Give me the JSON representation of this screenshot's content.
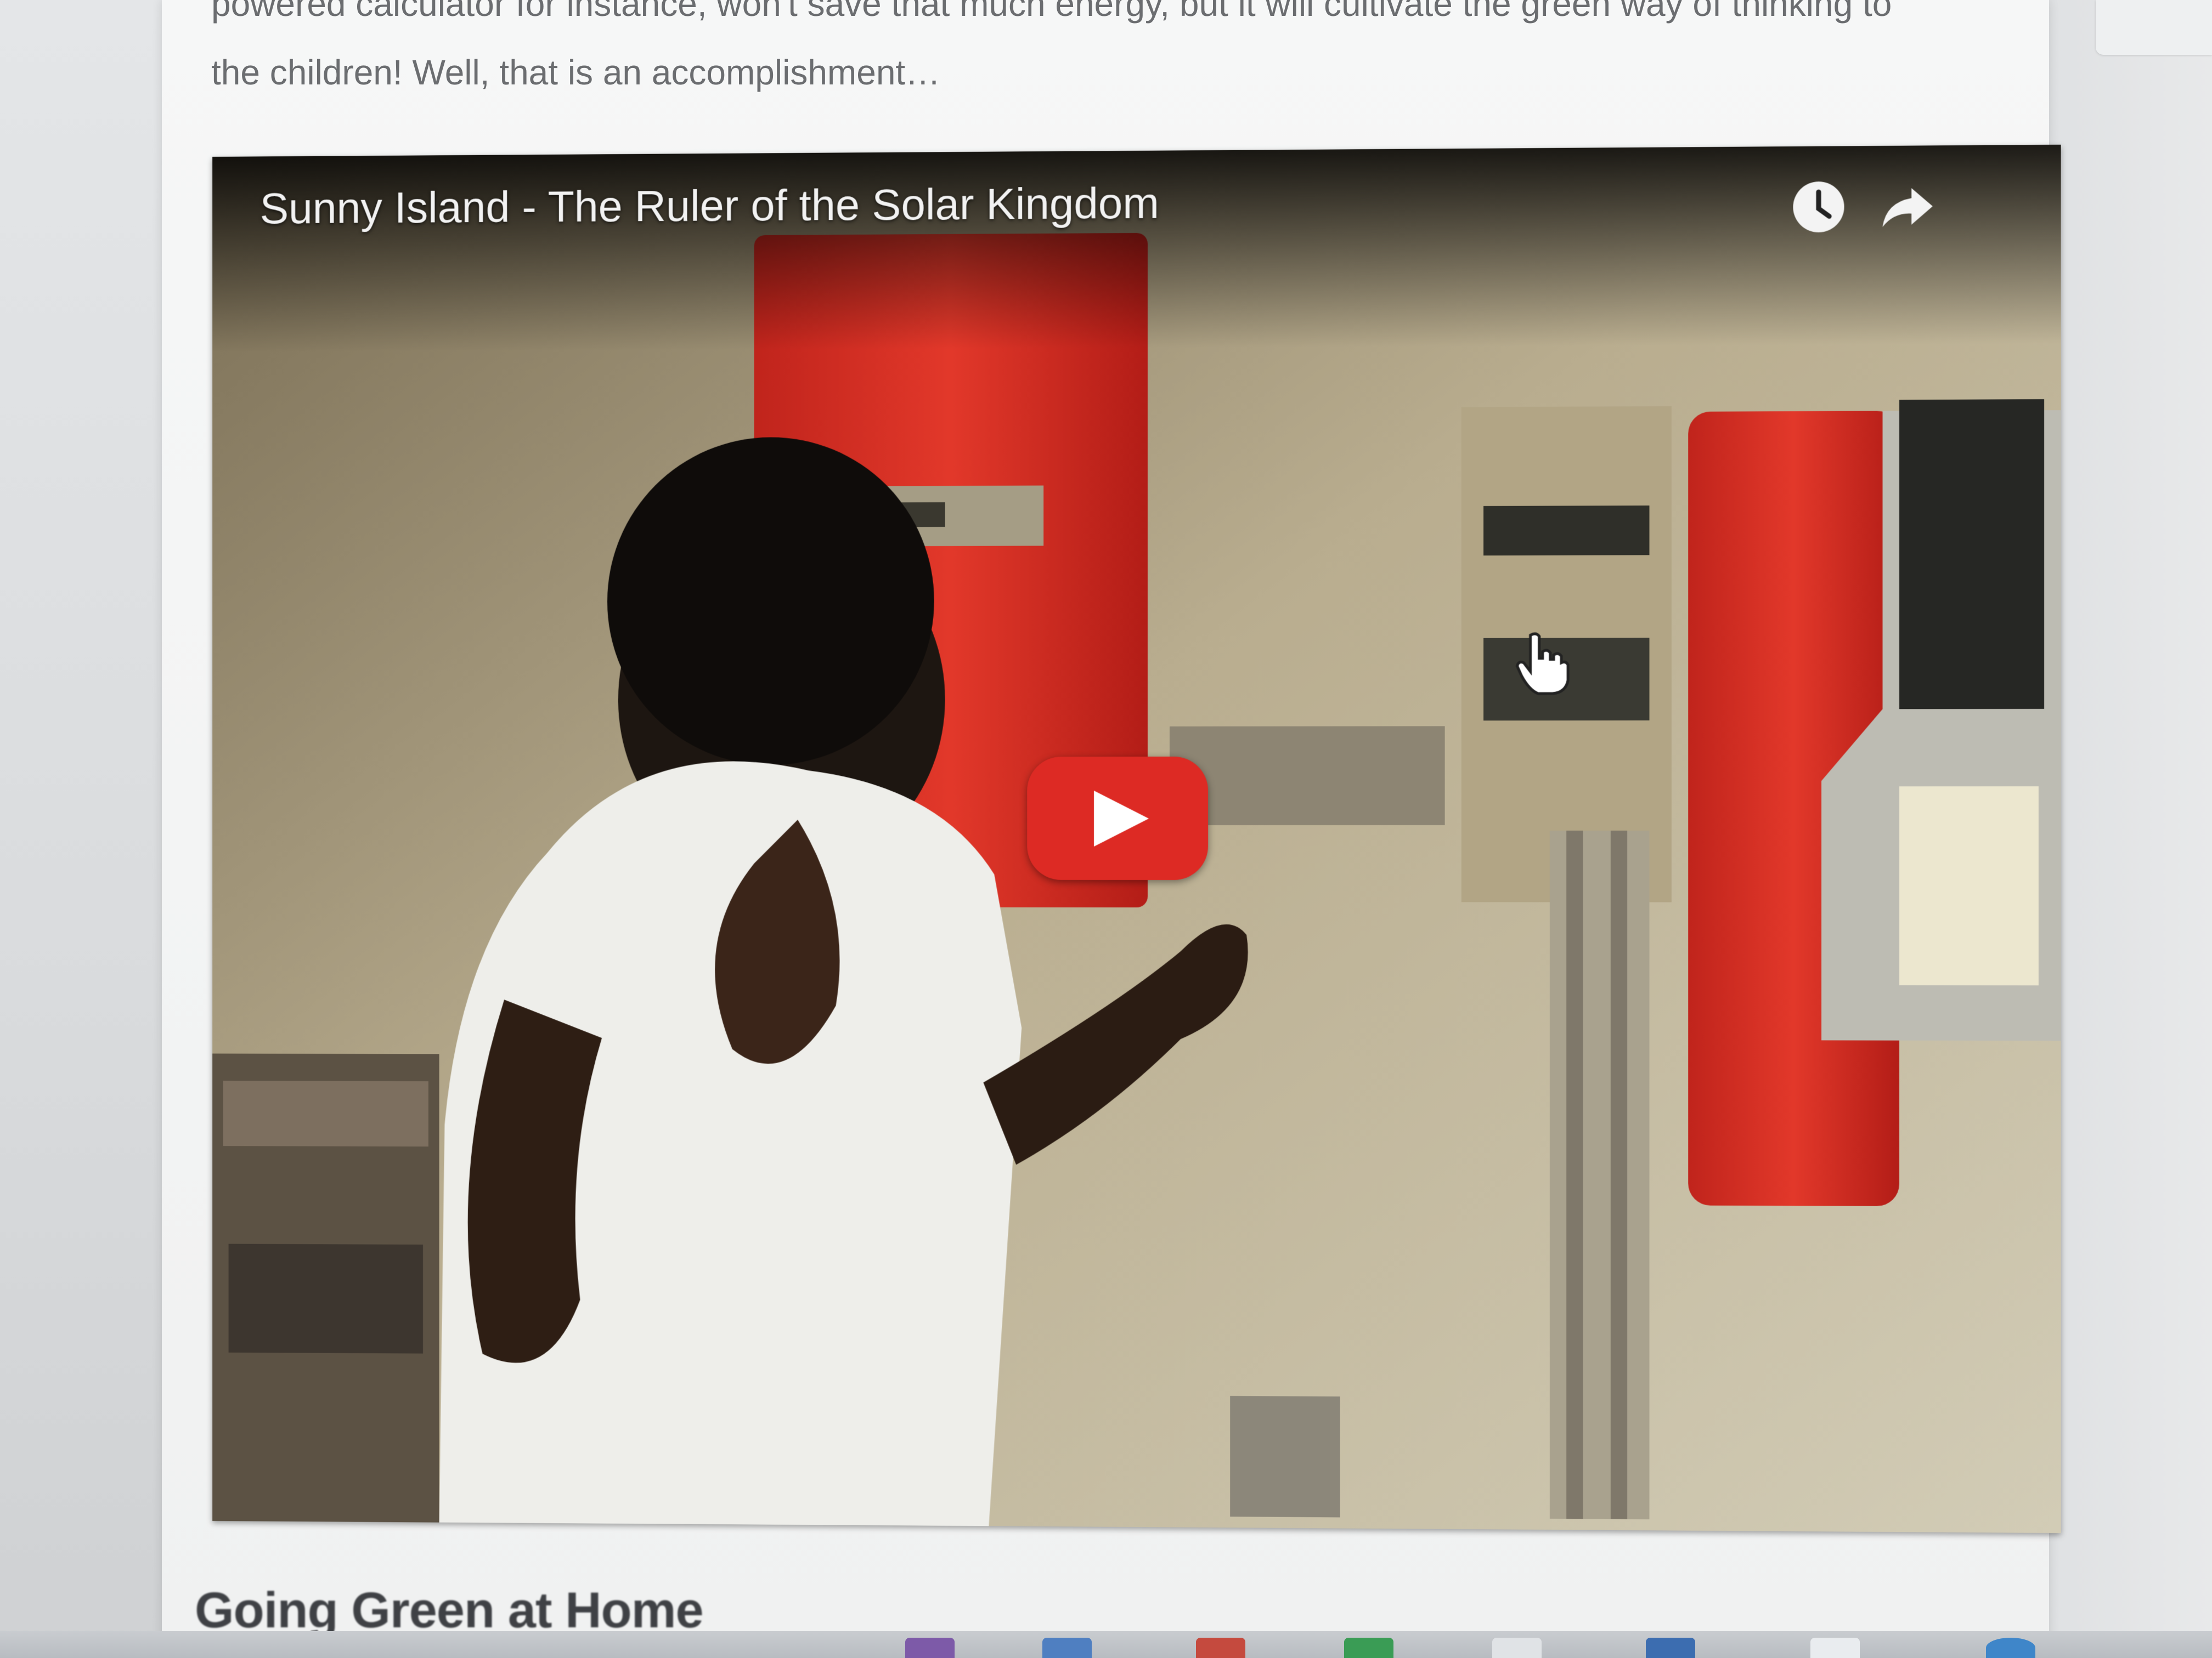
{
  "article": {
    "intro_line1": "powered calculator for instance, won't save that much energy, but it will cultivate the green way of thinking to",
    "intro_line2": "the children! Well, that is an accomplishment…",
    "next_heading": "Going Green at Home"
  },
  "video": {
    "title": "Sunny Island - The Ruler of the Solar Kingdom",
    "watch_later_icon": "clock-icon",
    "share_icon": "share-arrow-icon",
    "play_icon": "play-icon",
    "play_color": "#dd2a24"
  }
}
